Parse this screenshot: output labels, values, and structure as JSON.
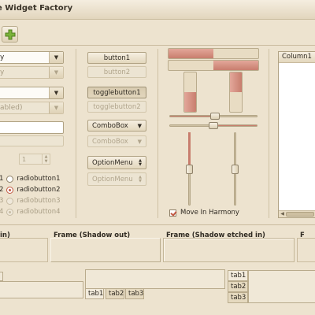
{
  "window": {
    "title": "e Widget Factory"
  },
  "toolbar": {
    "add_icon": "plus-icon"
  },
  "left": {
    "combo1_text": "y",
    "combo2_text": "y",
    "combo3_text": "",
    "combo4_text": "abled)",
    "spin_value": "1",
    "radios_left": [
      {
        "label": "1"
      },
      {
        "label": "2"
      },
      {
        "label": "3"
      },
      {
        "label": "4"
      }
    ],
    "radios": [
      {
        "label": "radiobutton1",
        "checked": false,
        "disabled": false
      },
      {
        "label": "radiobutton2",
        "checked": true,
        "disabled": false
      },
      {
        "label": "radiobutton3",
        "checked": false,
        "disabled": true
      },
      {
        "label": "radiobutton4",
        "checked": true,
        "disabled": true
      }
    ]
  },
  "buttons": {
    "button1": "button1",
    "button2": "button2",
    "toggle1": "togglebutton1",
    "toggle2": "togglebutton2",
    "combobox1": "ComboBox",
    "combobox2": "ComboBox",
    "optionmenu1": "OptionMenu",
    "optionmenu2": "OptionMenu"
  },
  "scales": {
    "hscale1_fraction": 0.5,
    "hscale2_fraction": 0.5,
    "vscale1_fraction": 0.5,
    "vscale2_fraction": 0.5,
    "move_in_harmony_label": "Move In Harmony",
    "move_in_harmony_checked": true
  },
  "treeview": {
    "column1": "Column1"
  },
  "frames": {
    "frame_in_label": "in)",
    "frame_out_label": "Frame (Shadow out)",
    "frame_etched_in_label": "Frame (Shadow etched in)",
    "frame_right_label": "F"
  },
  "notebooks": {
    "bottom_tabs": [
      "tab1",
      "tab2",
      "tab3"
    ],
    "side_tabs": [
      "tab1",
      "tab2",
      "tab3"
    ]
  },
  "colors": {
    "accent": "#c87e6e",
    "background": "#ede3cf",
    "plus_icon": "#7ab33a"
  }
}
